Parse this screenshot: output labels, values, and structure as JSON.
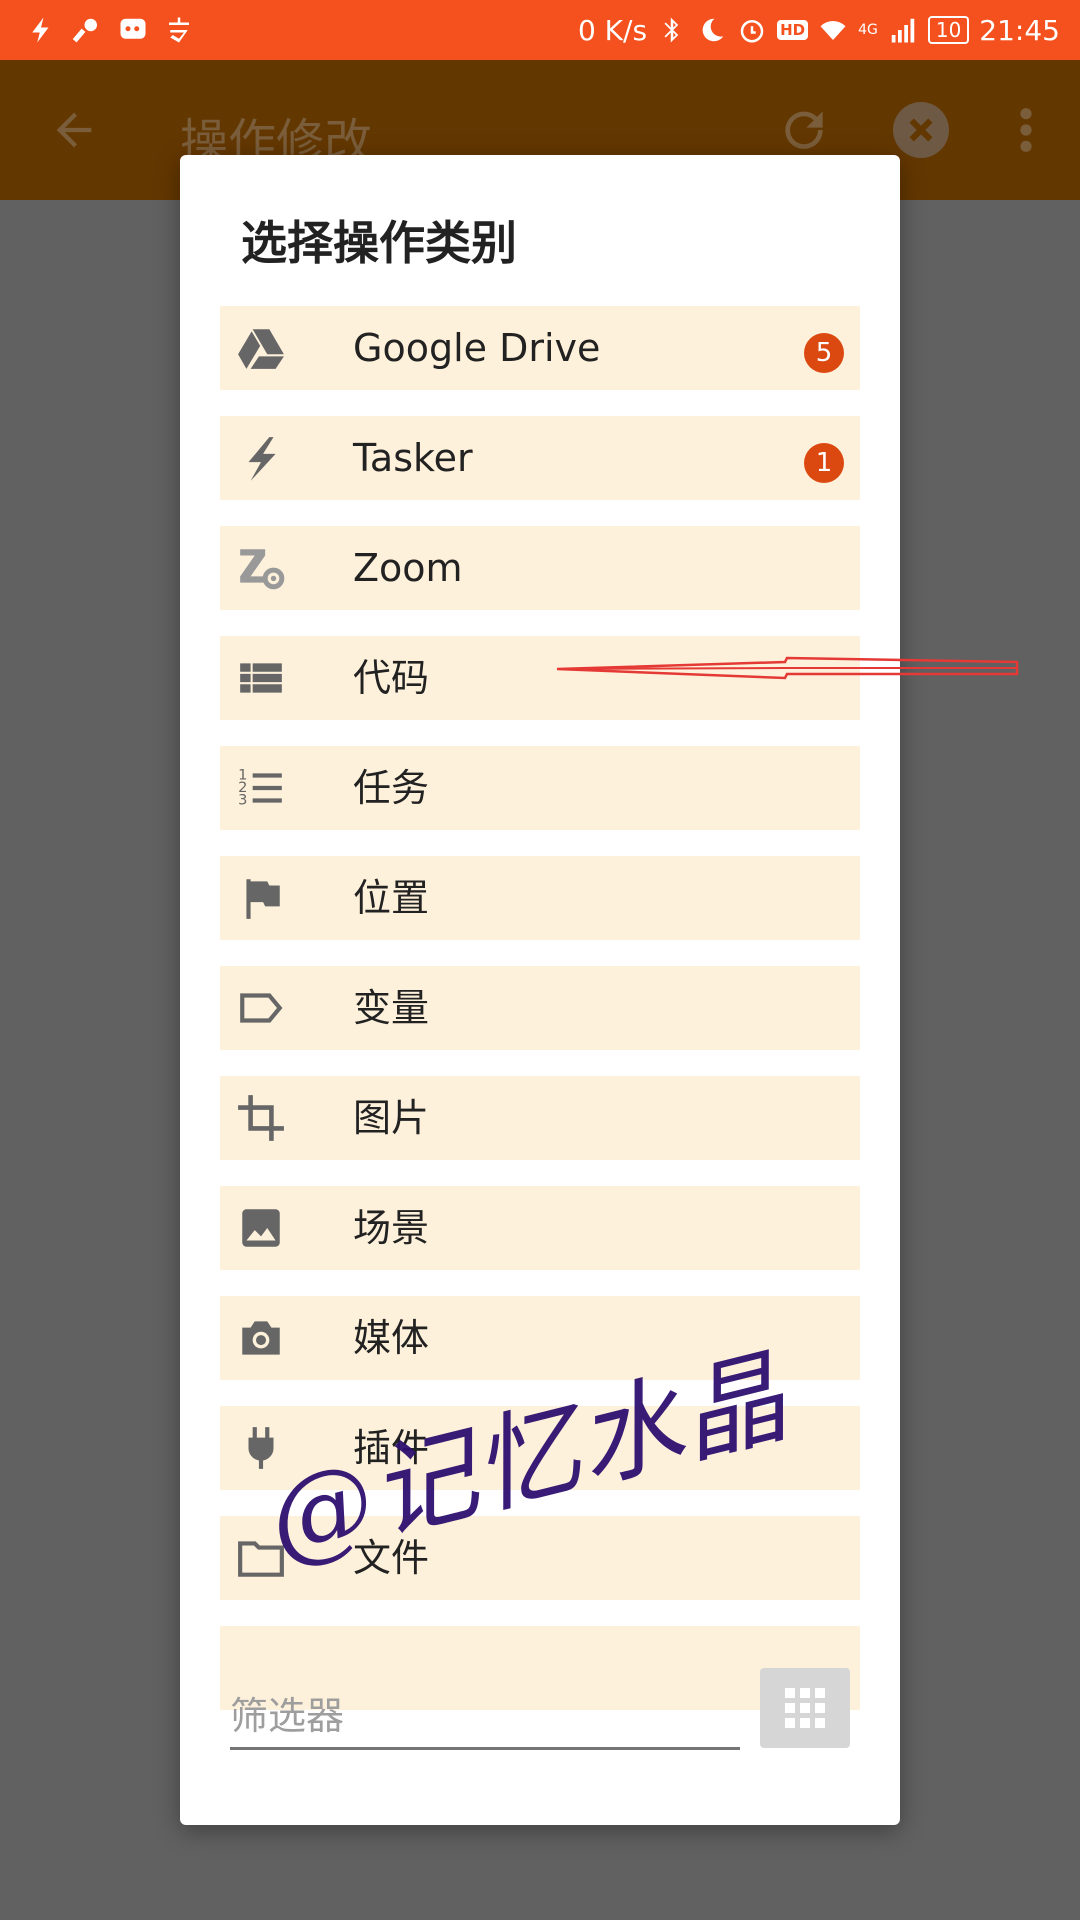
{
  "status_bar": {
    "net_speed": "0 K/s",
    "hd": "HD",
    "net_type": "4G",
    "battery": "10",
    "time": "21:45"
  },
  "toolbar": {
    "title": "操作修改"
  },
  "dialog": {
    "title": "选择操作类别",
    "items": [
      {
        "label": "Google Drive",
        "icon": "google-drive-icon",
        "badge": "5"
      },
      {
        "label": "Tasker",
        "icon": "tasker-bolt-icon",
        "badge": "1"
      },
      {
        "label": "Zoom",
        "icon": "zoom-icon"
      },
      {
        "label": "代码",
        "icon": "code-list-icon"
      },
      {
        "label": "任务",
        "icon": "numbered-list-icon"
      },
      {
        "label": "位置",
        "icon": "flag-icon"
      },
      {
        "label": "变量",
        "icon": "label-tag-icon"
      },
      {
        "label": "图片",
        "icon": "crop-icon"
      },
      {
        "label": "场景",
        "icon": "image-icon"
      },
      {
        "label": "媒体",
        "icon": "camera-icon"
      },
      {
        "label": "插件",
        "icon": "plug-icon"
      },
      {
        "label": "文件",
        "icon": "folder-icon"
      }
    ],
    "filter_placeholder": "筛选器"
  },
  "watermark": "@记忆水晶",
  "colors": {
    "status_bar": "#F4511E",
    "toolbar_dimmed": "#633700",
    "item_background": "#FEF1DB",
    "badge": "#DB4910",
    "icon": "#666666",
    "annotation": "#E53935",
    "watermark": "#2E1070"
  }
}
